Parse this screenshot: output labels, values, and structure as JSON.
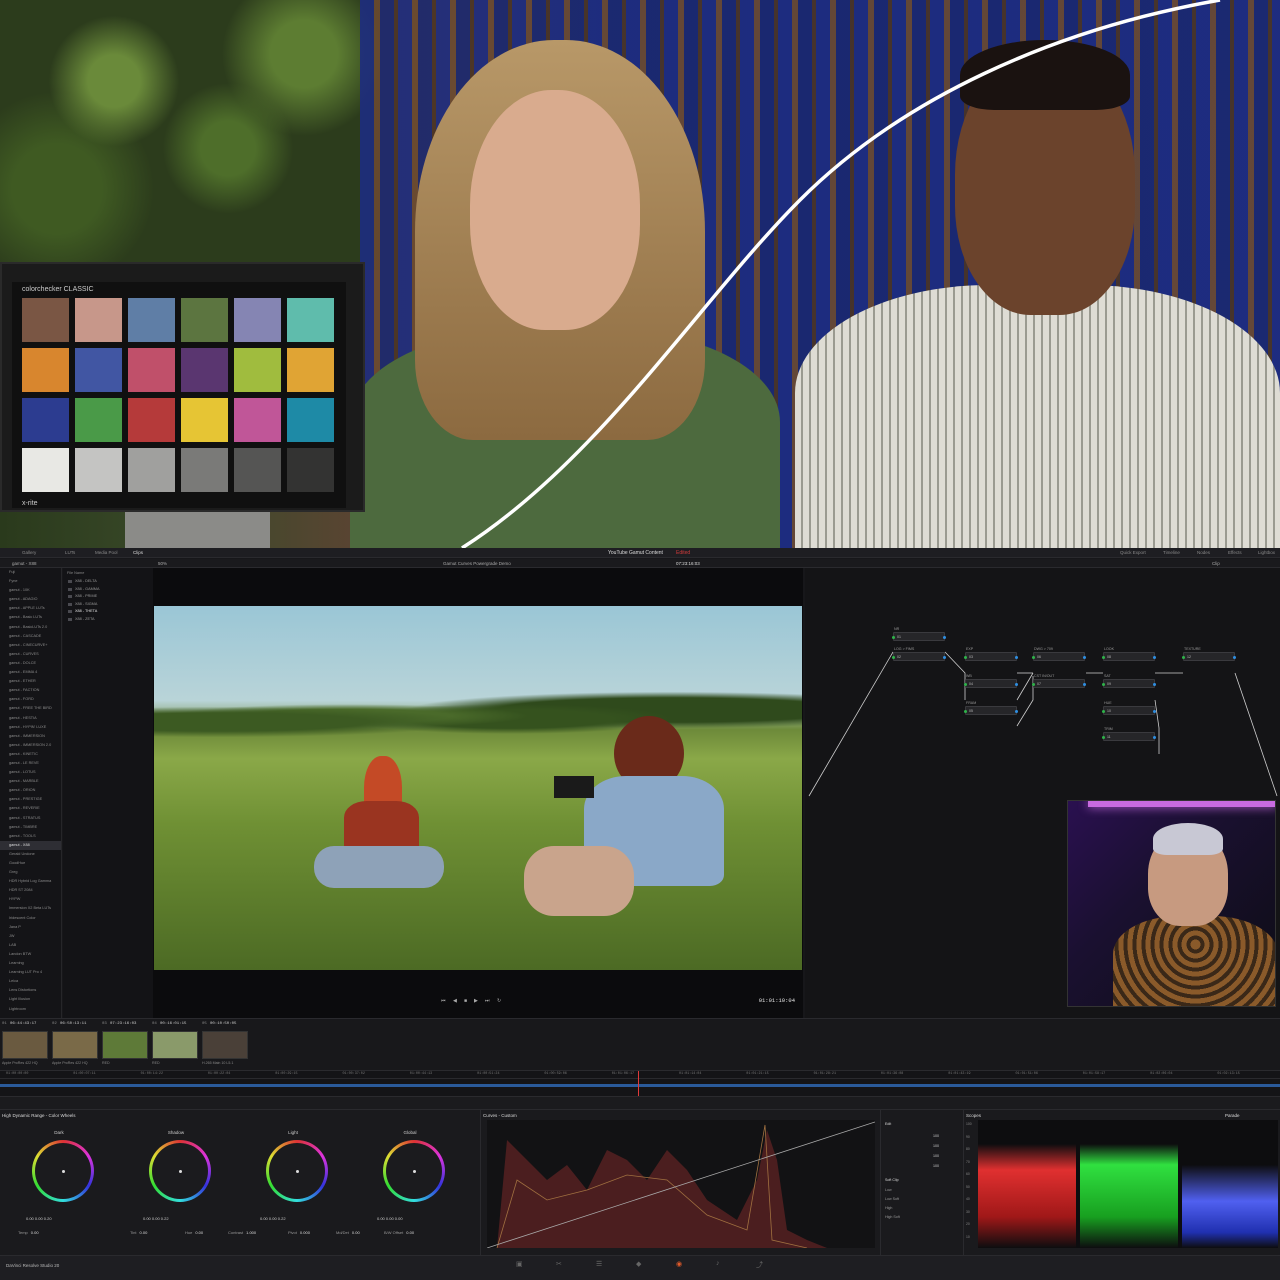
{
  "hero": {
    "colorchecker_brand": "colorchecker CLASSIC",
    "colorchecker_maker": "x-rite",
    "swatches": [
      "#7a5644",
      "#c7978a",
      "#5f7ea6",
      "#5c7540",
      "#8585b3",
      "#5fbcac",
      "#d8862e",
      "#4156a3",
      "#c0506a",
      "#5a3670",
      "#a0bc3e",
      "#e0a434",
      "#2c3c90",
      "#4a9a48",
      "#b53a3a",
      "#e6c534",
      "#c05698",
      "#1e8aa6",
      "#e8e8e4",
      "#c4c4c2",
      "#a0a09e",
      "#7a7a78",
      "#555554",
      "#333332"
    ]
  },
  "topbar": {
    "items": [
      "Gallery",
      "LUTs",
      "Media Pool",
      "Clips"
    ],
    "project_title": "YouTube Gamut Content",
    "edited": "Edited",
    "right_items": [
      "Quick Export",
      "Timeline",
      "Nodes",
      "Effects",
      "Lightbox"
    ]
  },
  "viewerbar": {
    "browser_title": "gamut - X88",
    "zoom": "50%",
    "clip_title": "Gamut Curves Powergrade Demo",
    "timecode": "07:23:16:03",
    "node_mode": "Clip"
  },
  "lut_browser": {
    "items": [
      "Fuji",
      "Fyne",
      "gamut - 10K",
      "gamut - ADAGIO",
      "gamut - APPLE LUTs",
      "gamut - Basic LUTs",
      "gamut - BasicLUTs 2.0",
      "gamut - CASCADE",
      "gamut - CINECURVE+",
      "gamut - CURVES",
      "gamut - DOLCE",
      "gamut - EMMA 4",
      "gamut - ETHER",
      "gamut - FACTION",
      "gamut - FORD",
      "gamut - FREE THE BIRD",
      "gamut - HESTIA",
      "gamut - HYPIN' LUXE",
      "gamut - IMMERSION",
      "gamut - IMMERSION 2.0",
      "gamut - KINETIC",
      "gamut - LE REVE",
      "gamut - LOTUS",
      "gamut - MARBLE",
      "gamut - ORION",
      "gamut - PRESTIGE",
      "gamut - REVERIE",
      "gamut - STRATUS",
      "gamut - TIMBRE",
      "gamut - TOOLS",
      "gamut - X88",
      "Gerald Undone",
      "GoodHue",
      "Greg",
      "HDR Hybrid Log Gamma",
      "HDR ST 2084",
      "HYPW",
      "Immersion X2 Beta LUTs",
      "Iridescent Color",
      "Jana P",
      "JW",
      "LAB",
      "Landon BTW",
      "Learning",
      "Learning LUT Pro 4",
      "Leica",
      "Lens Distortions",
      "Light Illusion",
      "Lightroom"
    ],
    "active_index": 30
  },
  "file_list": {
    "header": "File Name",
    "items": [
      "X88 - DELTA",
      "X88 - GAMMA",
      "X88 - PRIME",
      "X88 - SIGMA",
      "X88 - THETA",
      "X88 - ZETA"
    ],
    "active_index": 4
  },
  "viewer": {
    "timecode": "01:01:10:04"
  },
  "nodes": [
    {
      "label": "NR",
      "num": "01"
    },
    {
      "label": "LOG > FIMS",
      "num": "02"
    },
    {
      "label": "EXP",
      "num": "03"
    },
    {
      "label": "WB",
      "num": "04"
    },
    {
      "label": "FRAM",
      "num": "05"
    },
    {
      "label": "DWG > 709",
      "num": "06"
    },
    {
      "label": "CST IN/OUT",
      "num": "07"
    },
    {
      "label": "LOOK",
      "num": "08"
    },
    {
      "label": "SAT",
      "num": "09"
    },
    {
      "label": "HUE",
      "num": "10"
    },
    {
      "label": "TRIM",
      "num": "11"
    },
    {
      "label": "TEXTURE",
      "num": "12"
    }
  ],
  "clips": [
    {
      "index": "01",
      "tc": "06:44:43:17",
      "codec": "Apple ProRes 422 HQ",
      "color": "#6a5a40"
    },
    {
      "index": "02",
      "tc": "06:50:13:11",
      "codec": "Apple ProRes 422 HQ",
      "color": "#7a6a48"
    },
    {
      "index": "03",
      "tc": "07:23:16:03",
      "codec": "RED",
      "color": "#5e7a38"
    },
    {
      "index": "04",
      "tc": "00:16:01:15",
      "codec": "RED",
      "color": "#8a9a6a"
    },
    {
      "index": "05",
      "tc": "00:10:50:05",
      "codec": "H.265 Main 10 L5.1",
      "color": "#4a4038"
    }
  ],
  "ruler": [
    "01:00:00:00",
    "01:00:07:11",
    "01:00:14:22",
    "01:00:22:04",
    "01:00:29:15",
    "01:00:37:02",
    "01:00:44:13",
    "01:00:51:24",
    "01:00:59:06",
    "01:01:06:17",
    "01:01:14:04",
    "01:01:21:15",
    "01:01:28:21",
    "01:01:36:08",
    "01:01:43:19",
    "01:01:51:06",
    "01:01:58:17",
    "01:02:06:04",
    "01:02:13:15"
  ],
  "wheels_panel": {
    "title": "High Dynamic Range - Color Wheels",
    "wheels": [
      {
        "name": "Dark",
        "vals": "0.00   0.00   0.20"
      },
      {
        "name": "Shadow",
        "vals": "0.00   0.00   0.22"
      },
      {
        "name": "Light",
        "vals": "0.00   0.00   0.22"
      },
      {
        "name": "Global",
        "vals": "0.00   0.00   0.00"
      }
    ],
    "params": [
      {
        "label": "Temp",
        "value": "0.00"
      },
      {
        "label": "Tint",
        "value": "0.00"
      },
      {
        "label": "Hue",
        "value": "0.00"
      },
      {
        "label": "Contrast",
        "value": "1.000"
      },
      {
        "label": "Pivot",
        "value": "0.000"
      },
      {
        "label": "Md/Det",
        "value": "0.00"
      },
      {
        "label": "B/W Offset",
        "value": "0.00"
      }
    ]
  },
  "curves_panel": {
    "title": "Curves - Custom"
  },
  "soft_clip": {
    "edit_label": "Edit",
    "values": [
      "100",
      "100",
      "100",
      "100"
    ],
    "section": "Soft Clip",
    "rows": [
      "Low",
      "Low Soft",
      "High",
      "High Soft"
    ]
  },
  "scopes": {
    "title": "Scopes",
    "mode": "Parade",
    "scale": [
      "100",
      "90",
      "80",
      "70",
      "60",
      "50",
      "40",
      "30",
      "20",
      "10"
    ]
  },
  "statusbar": {
    "app_name": "DaVinci Resolve Studio 20"
  }
}
